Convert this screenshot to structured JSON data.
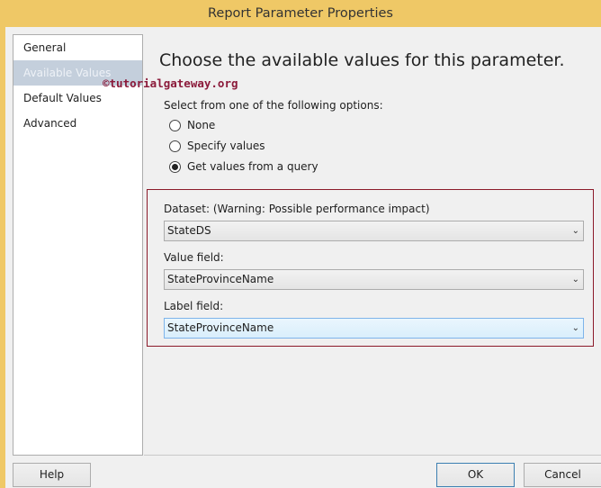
{
  "window": {
    "title": "Report Parameter Properties"
  },
  "nav": {
    "items": [
      {
        "label": "General"
      },
      {
        "label": "Available Values"
      },
      {
        "label": "Default Values"
      },
      {
        "label": "Advanced"
      }
    ]
  },
  "watermark": "©tutorialgateway.org",
  "main": {
    "heading": "Choose the available values for this parameter.",
    "select_label": "Select from one of the following options:",
    "options": [
      {
        "label": "None",
        "selected": false
      },
      {
        "label": "Specify values",
        "selected": false
      },
      {
        "label": "Get values from a query",
        "selected": true
      }
    ],
    "dataset_label": "Dataset: (Warning: Possible performance impact)",
    "dataset_value": "StateDS",
    "value_field_label": "Value field:",
    "value_field_value": "StateProvinceName",
    "label_field_label": "Label field:",
    "label_field_value": "StateProvinceName"
  },
  "buttons": {
    "help": "Help",
    "ok": "OK",
    "cancel": "Cancel"
  }
}
